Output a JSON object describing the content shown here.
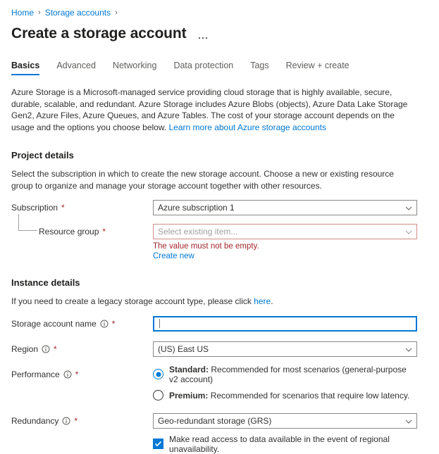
{
  "breadcrumb": {
    "items": [
      {
        "label": "Home"
      },
      {
        "label": "Storage accounts"
      }
    ],
    "separator": "›"
  },
  "header": {
    "title": "Create a storage account",
    "more_menu": "…"
  },
  "tabs": [
    {
      "label": "Basics",
      "active": true
    },
    {
      "label": "Advanced",
      "active": false
    },
    {
      "label": "Networking",
      "active": false
    },
    {
      "label": "Data protection",
      "active": false
    },
    {
      "label": "Tags",
      "active": false
    },
    {
      "label": "Review + create",
      "active": false
    }
  ],
  "intro": {
    "text": "Azure Storage is a Microsoft-managed service providing cloud storage that is highly available, secure, durable, scalable, and redundant. Azure Storage includes Azure Blobs (objects), Azure Data Lake Storage Gen2, Azure Files, Azure Queues, and Azure Tables. The cost of your storage account depends on the usage and the options you choose below. ",
    "link": "Learn more about Azure storage accounts"
  },
  "project_details": {
    "heading": "Project details",
    "description": "Select the subscription in which to create the new storage account. Choose a new or existing resource group to organize and manage your storage account together with other resources.",
    "subscription": {
      "label": "Subscription",
      "required": "*",
      "value": "Azure subscription 1"
    },
    "resource_group": {
      "label": "Resource group",
      "required": "*",
      "placeholder": "Select existing item...",
      "error": "The value must not be empty.",
      "create_new": "Create new"
    }
  },
  "instance_details": {
    "heading": "Instance details",
    "description_prefix": "If you need to create a legacy storage account type, please click ",
    "description_link": "here",
    "description_suffix": ".",
    "storage_account_name": {
      "label": "Storage account name",
      "required": "*",
      "value": "",
      "placeholder": ""
    },
    "region": {
      "label": "Region",
      "required": "*",
      "value": "(US) East US"
    },
    "performance": {
      "label": "Performance",
      "required": "*",
      "options": [
        {
          "name": "Standard:",
          "description": " Recommended for most scenarios (general-purpose v2 account)",
          "checked": true
        },
        {
          "name": "Premium:",
          "description": " Recommended for scenarios that require low latency.",
          "checked": false
        }
      ]
    },
    "redundancy": {
      "label": "Redundancy",
      "required": "*",
      "value": "Geo-redundant storage (GRS)",
      "checkbox_label": "Make read access to data available in the event of regional unavailability.",
      "checkbox_checked": true
    }
  },
  "colors": {
    "accent": "#0078d4",
    "error": "#a4262c",
    "error_border": "#d08b8b",
    "text": "#323130",
    "border": "#8a8886"
  }
}
